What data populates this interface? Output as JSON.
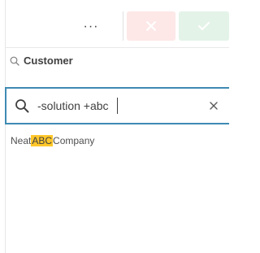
{
  "toolbar": {
    "more_label": "···",
    "cancel_icon": "close-icon",
    "confirm_icon": "check-icon",
    "cancel_color": "#fde7e7",
    "confirm_color": "#e4f3e8"
  },
  "header": {
    "icon": "search-icon",
    "title": "Customer"
  },
  "search": {
    "value": "-solution +abc",
    "placeholder": "",
    "border_color": "#3f8ab3"
  },
  "results": [
    {
      "before": "Neat ",
      "match": "ABC",
      "after": " Company"
    }
  ],
  "highlight_color": "#ffc72a"
}
